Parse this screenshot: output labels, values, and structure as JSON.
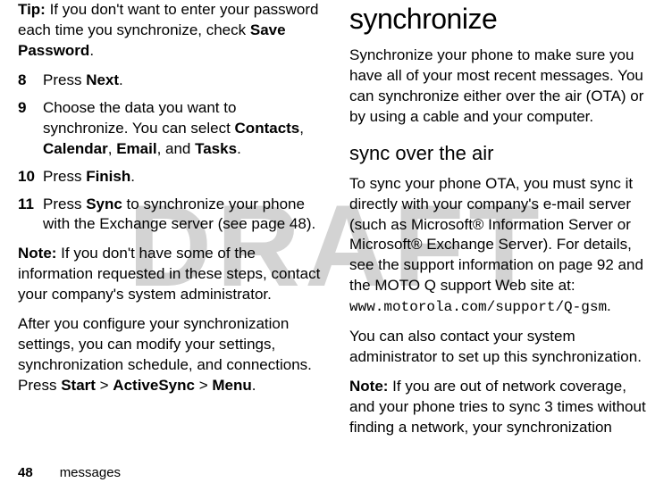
{
  "left": {
    "tip_label": "Tip:",
    "tip_text": " If you don't want to enter your password each time you synchronize, check ",
    "tip_bold": "Save Password",
    "period": ".",
    "step8_num": "8",
    "step8_press": "Press ",
    "step8_bold": "Next",
    "step9_num": "9",
    "step9_text1": "Choose the data you want to synchronize. You can select ",
    "step9_contacts": "Contacts",
    "step9_sep1": ", ",
    "step9_calendar": "Calendar",
    "step9_sep2": ", ",
    "step9_email": "Email",
    "step9_sep3": ", and ",
    "step9_tasks": "Tasks",
    "step10_num": "10",
    "step10_press": "Press ",
    "step10_bold": "Finish",
    "step11_num": "11",
    "step11_press": "Press ",
    "step11_bold": "Sync",
    "step11_text": " to synchronize your phone with the Exchange server (see page 48).",
    "note_label": "Note:",
    "note_text": " If you don't have some of the information requested in these steps, contact your company's system administrator.",
    "after_text1": "After you configure your synchronization settings, you can modify your settings, synchronization schedule, and connections. Press ",
    "after_start": "Start",
    "after_gt1": " > ",
    "after_activesync": "ActiveSync",
    "after_gt2": " > ",
    "after_menu": "Menu"
  },
  "right": {
    "h1": "synchronize",
    "p1": "Synchronize your phone to make sure you have all of your most recent messages. You can synchronize either over the air (OTA) or by using a cable and your computer.",
    "h2": "sync over the air",
    "p2": "To sync your phone OTA, you must sync it directly with your company's e-mail server (such as Microsoft® Information Server or Microsoft® Exchange Server). For details, see the support information on page 92 and the MOTO Q support Web site at: ",
    "url": "www.motorola.com/support/Q-gsm",
    "p2end": ".",
    "p3": "You can also contact your system administrator to set up this synchronization.",
    "note2_label": "Note:",
    "note2_text": "  If you are out of network coverage, and your phone tries to sync 3 times without finding a network, your synchronization"
  },
  "footer": {
    "page": "48",
    "section": "messages"
  },
  "watermark": "DRAFT"
}
